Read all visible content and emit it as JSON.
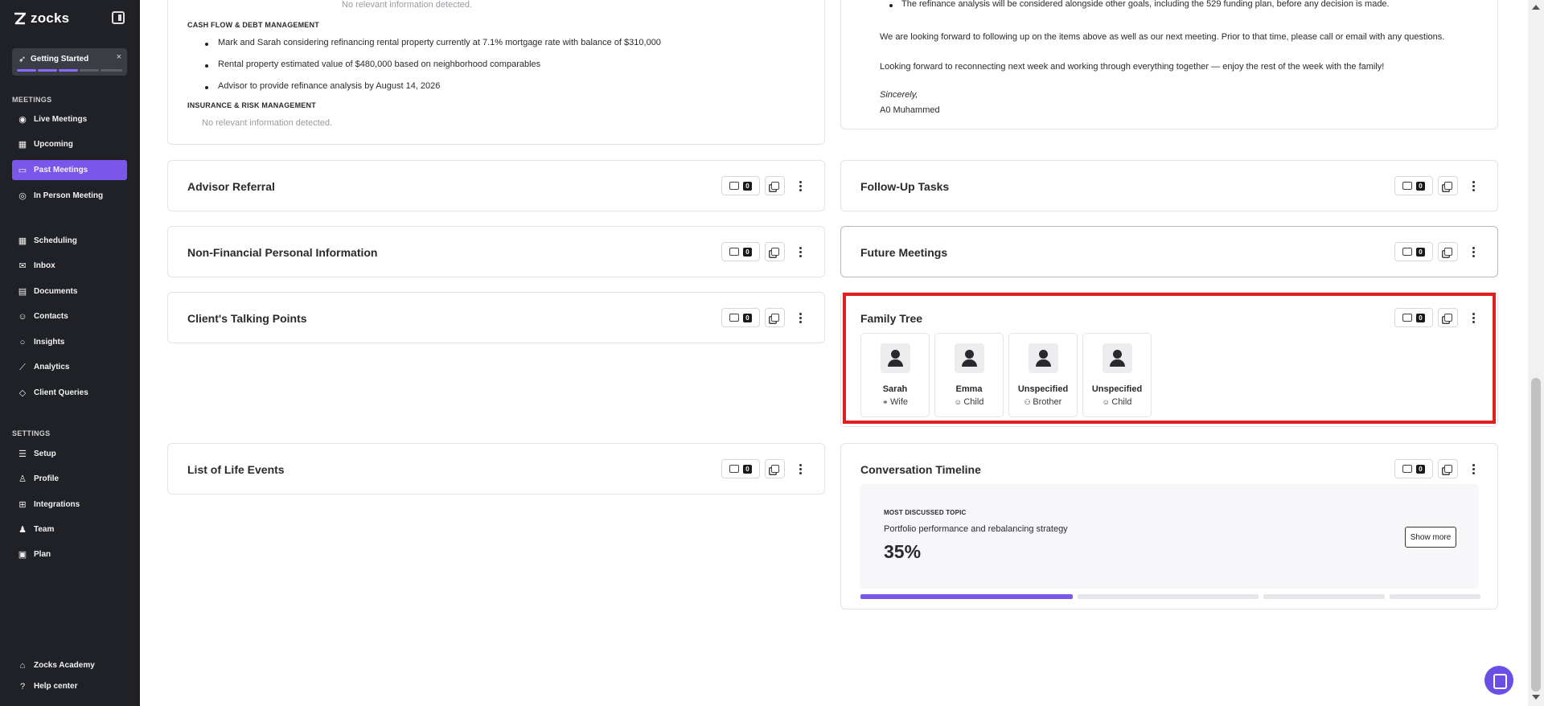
{
  "brand": {
    "name": "zocks"
  },
  "getting_started": {
    "label": "Getting Started",
    "close": "×"
  },
  "sidebar": {
    "meetings_title": "MEETINGS",
    "settings_title": "SETTINGS",
    "items": [
      {
        "label": "Live Meetings",
        "icon": "radio-icon"
      },
      {
        "label": "Upcoming",
        "icon": "calendar-icon"
      },
      {
        "label": "Past Meetings",
        "icon": "folder-icon"
      },
      {
        "label": "In Person Meeting",
        "icon": "record-icon"
      },
      {
        "label": "Scheduling",
        "icon": "calendar-icon"
      },
      {
        "label": "Inbox",
        "icon": "mail-icon"
      },
      {
        "label": "Documents",
        "icon": "document-icon"
      },
      {
        "label": "Contacts",
        "icon": "contacts-icon"
      },
      {
        "label": "Insights",
        "icon": "lightbulb-icon"
      },
      {
        "label": "Analytics",
        "icon": "chart-line-icon"
      },
      {
        "label": "Client Queries",
        "icon": "diamond-icon"
      }
    ],
    "settings_items": [
      {
        "label": "Setup",
        "icon": "sliders-icon"
      },
      {
        "label": "Profile",
        "icon": "user-icon"
      },
      {
        "label": "Integrations",
        "icon": "grid-icon"
      },
      {
        "label": "Team",
        "icon": "team-icon"
      },
      {
        "label": "Plan",
        "icon": "plan-icon"
      }
    ],
    "footer_items": [
      {
        "label": "Zocks Academy",
        "icon": "graduation-icon"
      },
      {
        "label": "Help center",
        "icon": "help-icon"
      }
    ]
  },
  "left_top": {
    "no_info_1": "No relevant information detected.",
    "cashflow_heading": "CASH FLOW & DEBT MANAGEMENT",
    "cashflow_bullets": [
      "Mark and Sarah considering refinancing rental property currently at 7.1% mortgage rate with balance of $310,000",
      "Rental property estimated value of $480,000 based on neighborhood comparables",
      "Advisor to provide refinance analysis by August 14, 2026"
    ],
    "insurance_heading": "INSURANCE & RISK MANAGEMENT",
    "no_info_2": "No relevant information detected."
  },
  "right_top": {
    "bullet": "The refinance analysis will be considered alongside other goals, including the 529 funding plan, before any decision is made.",
    "para1": "We are looking forward to following up on the items above as well as our next meeting. Prior to that time, please call or email with any questions.",
    "para2": "Looking forward to reconnecting next week and working through everything together — enjoy the rest of the week with the family!",
    "signoff": "Sincerely,",
    "signature": "A0 Muhammed"
  },
  "cards": {
    "advisor_referral": {
      "title": "Advisor Referral",
      "count": "0"
    },
    "follow_up": {
      "title": "Follow-Up Tasks",
      "count": "0"
    },
    "non_financial": {
      "title": "Non-Financial Personal Information",
      "count": "0"
    },
    "future_meetings": {
      "title": "Future Meetings",
      "count": "0"
    },
    "talking_points": {
      "title": "Client's Talking Points",
      "count": "0"
    },
    "family_tree": {
      "title": "Family Tree",
      "count": "0"
    },
    "life_events": {
      "title": "List of Life Events",
      "count": "0"
    },
    "timeline": {
      "title": "Conversation Timeline",
      "count": "0"
    }
  },
  "family": [
    {
      "name": "Sarah",
      "relation": "Wife",
      "icon": "rings-icon"
    },
    {
      "name": "Emma",
      "relation": "Child",
      "icon": "baby-icon"
    },
    {
      "name": "Unspecified",
      "relation": "Brother",
      "icon": "people-icon"
    },
    {
      "name": "Unspecified",
      "relation": "Child",
      "icon": "baby-icon"
    }
  ],
  "timeline": {
    "label": "MOST DISCUSSED TOPIC",
    "topic": "Portfolio performance and rebalancing strategy",
    "percent": "35%",
    "show_more": "Show more",
    "segments": [
      35,
      30,
      20,
      15
    ],
    "accent": "#7a57e8"
  }
}
